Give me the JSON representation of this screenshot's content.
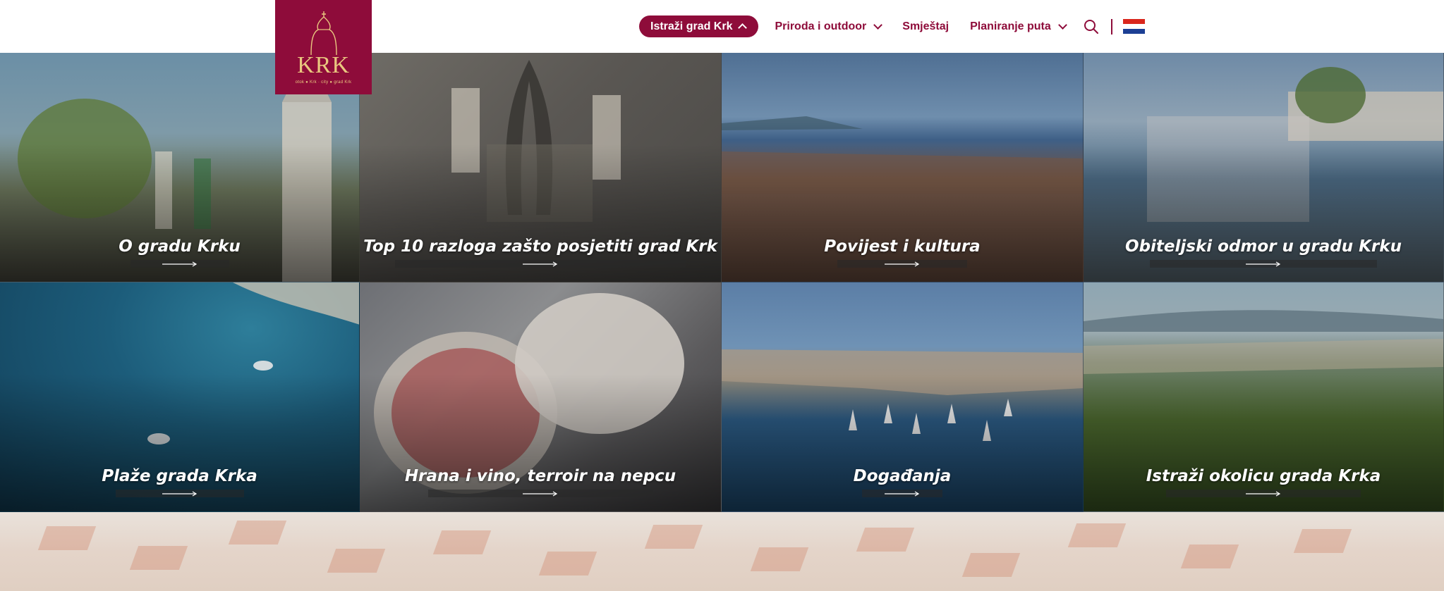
{
  "header": {
    "logo": {
      "word": "KRK",
      "tagline": "otok ● Krk · city ● grad Krk"
    },
    "nav": [
      {
        "label": "Istraži grad Krk",
        "active": true,
        "expanded": true
      },
      {
        "label": "Priroda i outdoor",
        "has_dropdown": true
      },
      {
        "label": "Smještaj"
      },
      {
        "label": "Planiranje puta",
        "has_dropdown": true
      }
    ],
    "search_icon": "search-icon",
    "language_flag": "croatian-flag-icon"
  },
  "tiles": [
    {
      "title": "O gradu Krku"
    },
    {
      "title": "Top 10 razloga zašto posjetiti grad Krk"
    },
    {
      "title": "Povijest i kultura"
    },
    {
      "title": "Obiteljski odmor u gradu Krku"
    },
    {
      "title": "Plaže grada Krka"
    },
    {
      "title": "Hrana i vino, terroir na nepcu"
    },
    {
      "title": "Događanja"
    },
    {
      "title": "Istraži okolicu grada Krka"
    }
  ],
  "colors": {
    "brand": "#8e0c3a",
    "logo_gold": "#e9c77f"
  }
}
